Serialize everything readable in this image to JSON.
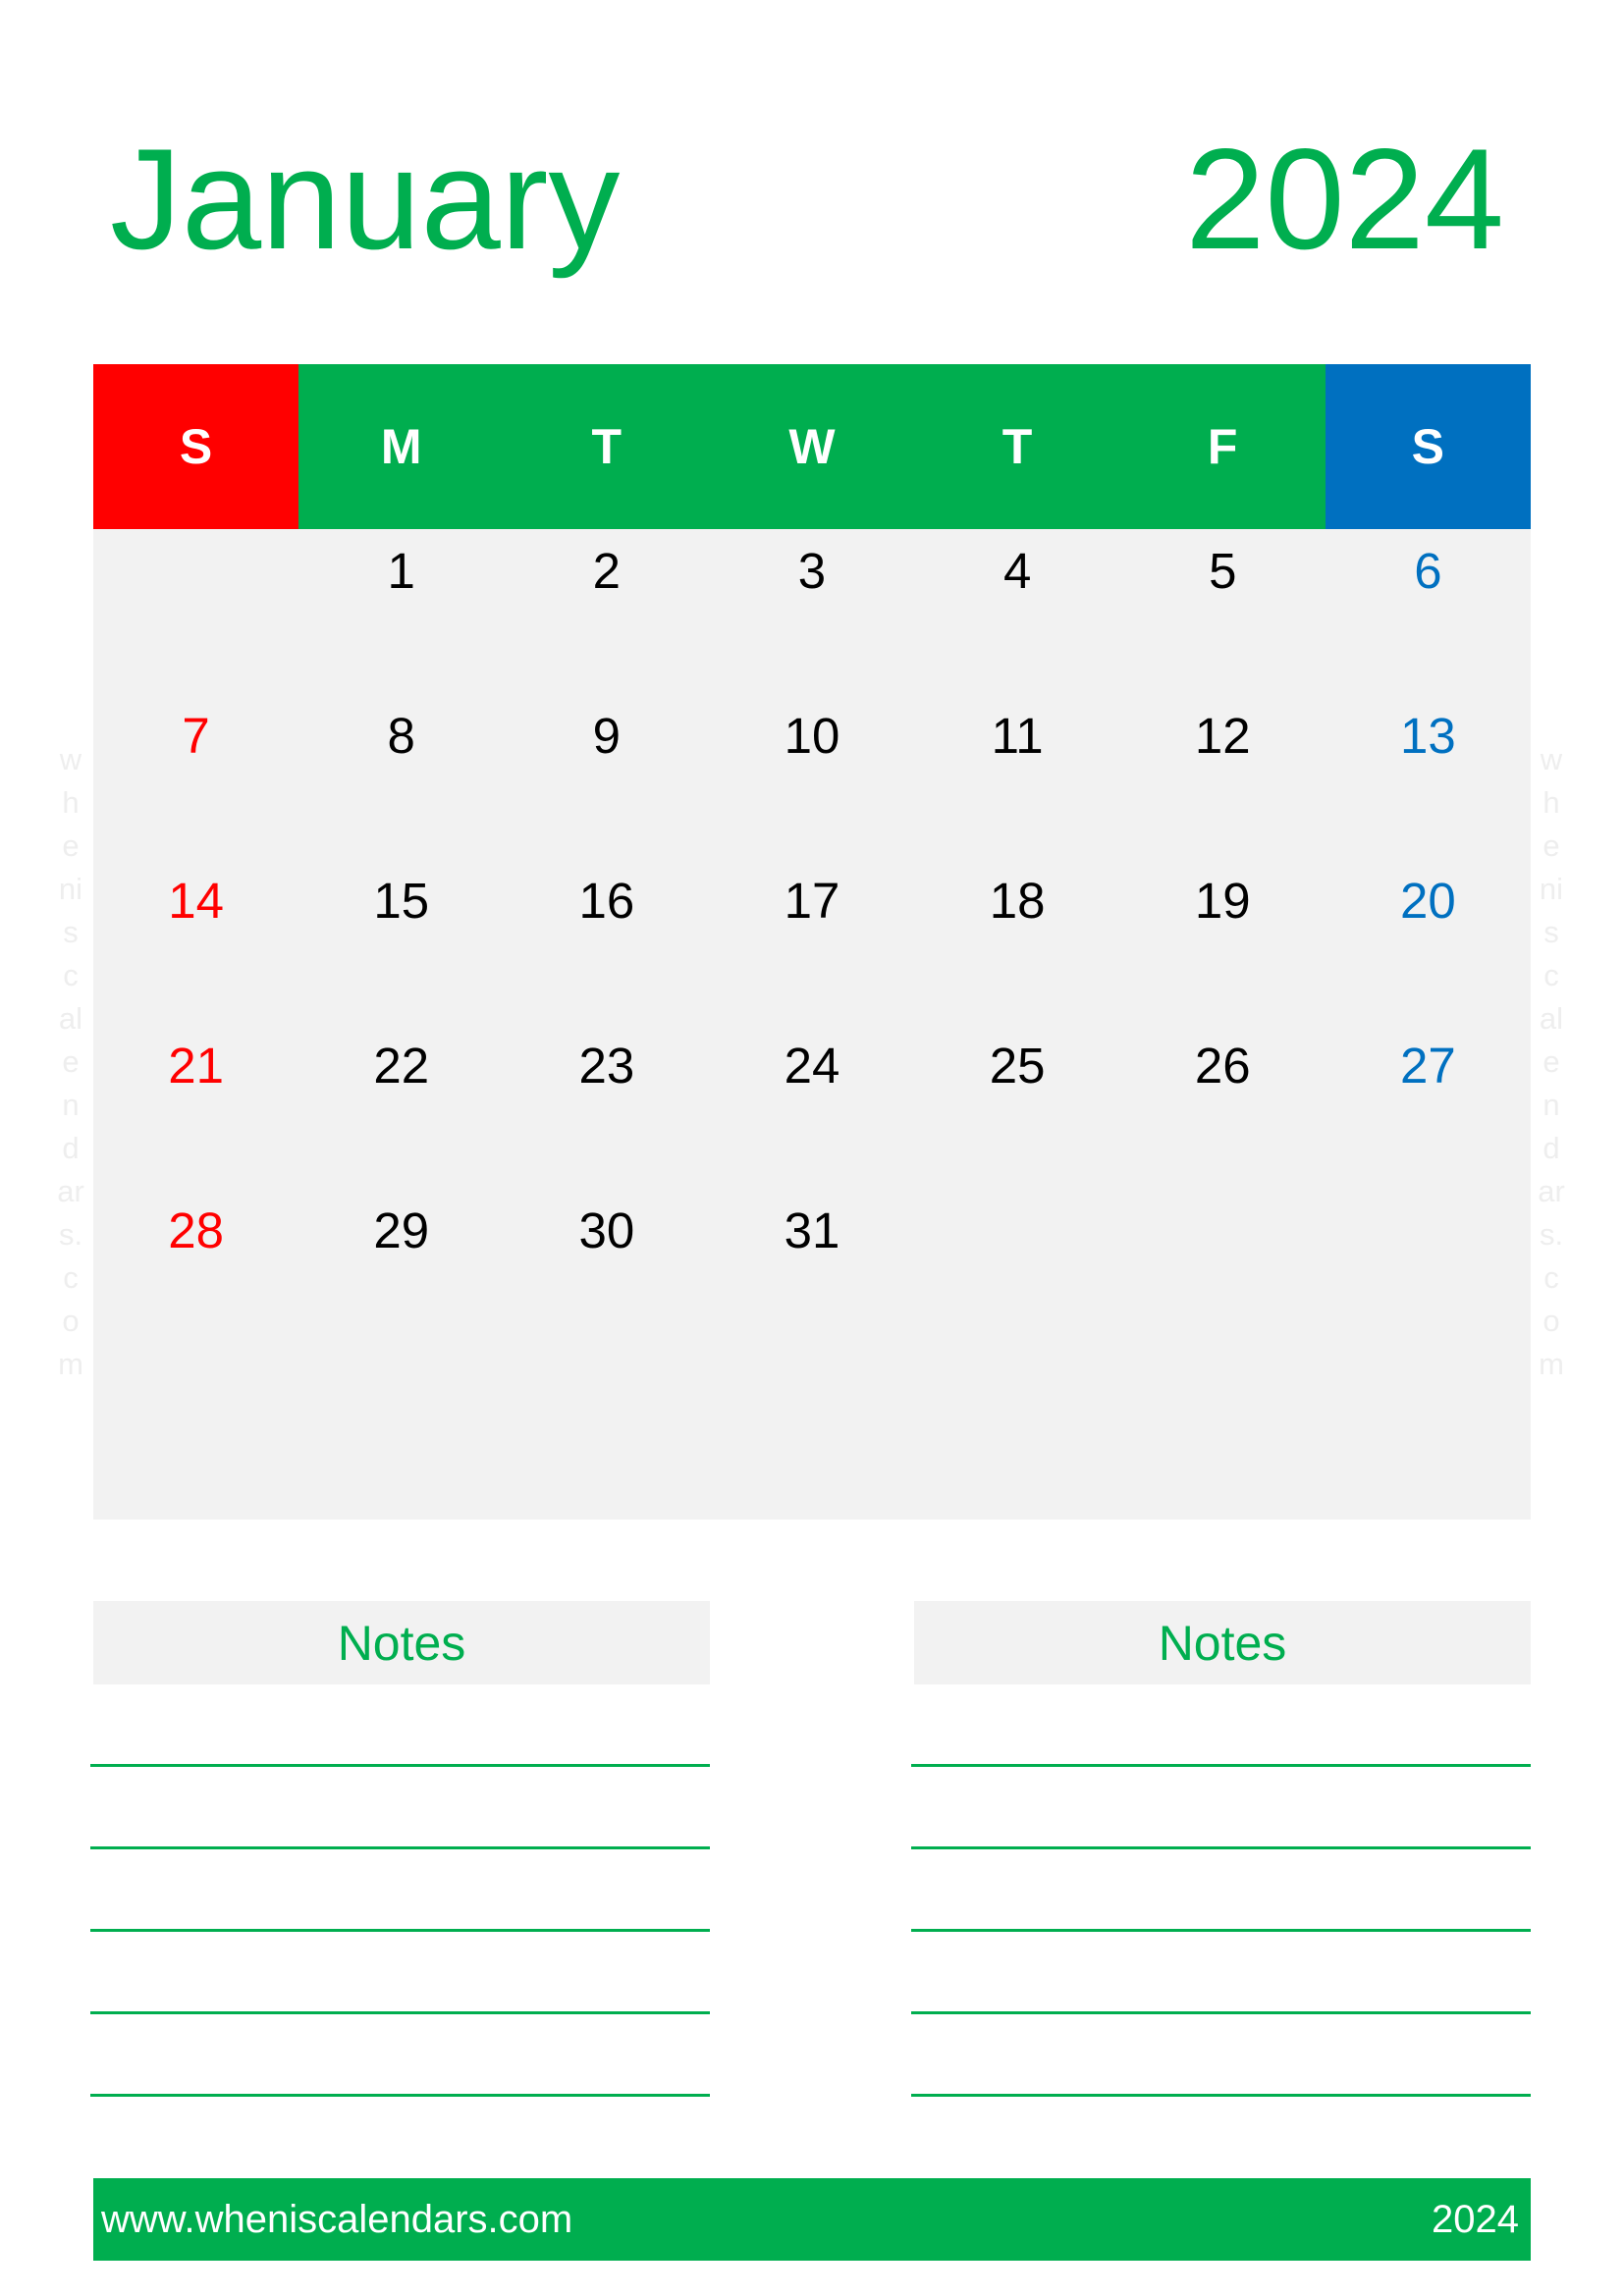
{
  "header": {
    "month": "January",
    "year": "2024"
  },
  "colors": {
    "brand_green": "#00AE4F",
    "sunday_red": "#FF0000",
    "saturday_blue": "#0070C0",
    "grid_bg": "#F2F2F2",
    "watermark": "#EEEEEE"
  },
  "weekdays": [
    {
      "label": "S",
      "color": "#FF0000"
    },
    {
      "label": "M",
      "color": "#00AE4F"
    },
    {
      "label": "T",
      "color": "#00AE4F"
    },
    {
      "label": "W",
      "color": "#00AE4F"
    },
    {
      "label": "T",
      "color": "#00AE4F"
    },
    {
      "label": "F",
      "color": "#00AE4F"
    },
    {
      "label": "S",
      "color": "#0070C0"
    }
  ],
  "weeks": [
    [
      "",
      "1",
      "2",
      "3",
      "4",
      "5",
      "6"
    ],
    [
      "7",
      "8",
      "9",
      "10",
      "11",
      "12",
      "13"
    ],
    [
      "14",
      "15",
      "16",
      "17",
      "18",
      "19",
      "20"
    ],
    [
      "21",
      "22",
      "23",
      "24",
      "25",
      "26",
      "27"
    ],
    [
      "28",
      "29",
      "30",
      "31",
      "",
      "",
      ""
    ],
    [
      "",
      "",
      "",
      "",
      "",
      "",
      ""
    ]
  ],
  "watermark": {
    "lines": [
      "w",
      "h",
      "e",
      "ni",
      "s",
      "c",
      "al",
      "e",
      "n",
      "d",
      "ar",
      "s.",
      "c",
      "o",
      "m"
    ]
  },
  "notes": [
    {
      "title": "Notes",
      "line_count": 5
    },
    {
      "title": "Notes",
      "line_count": 5
    }
  ],
  "footer": {
    "url": "www.wheniscalendars.com",
    "year": "2024"
  }
}
